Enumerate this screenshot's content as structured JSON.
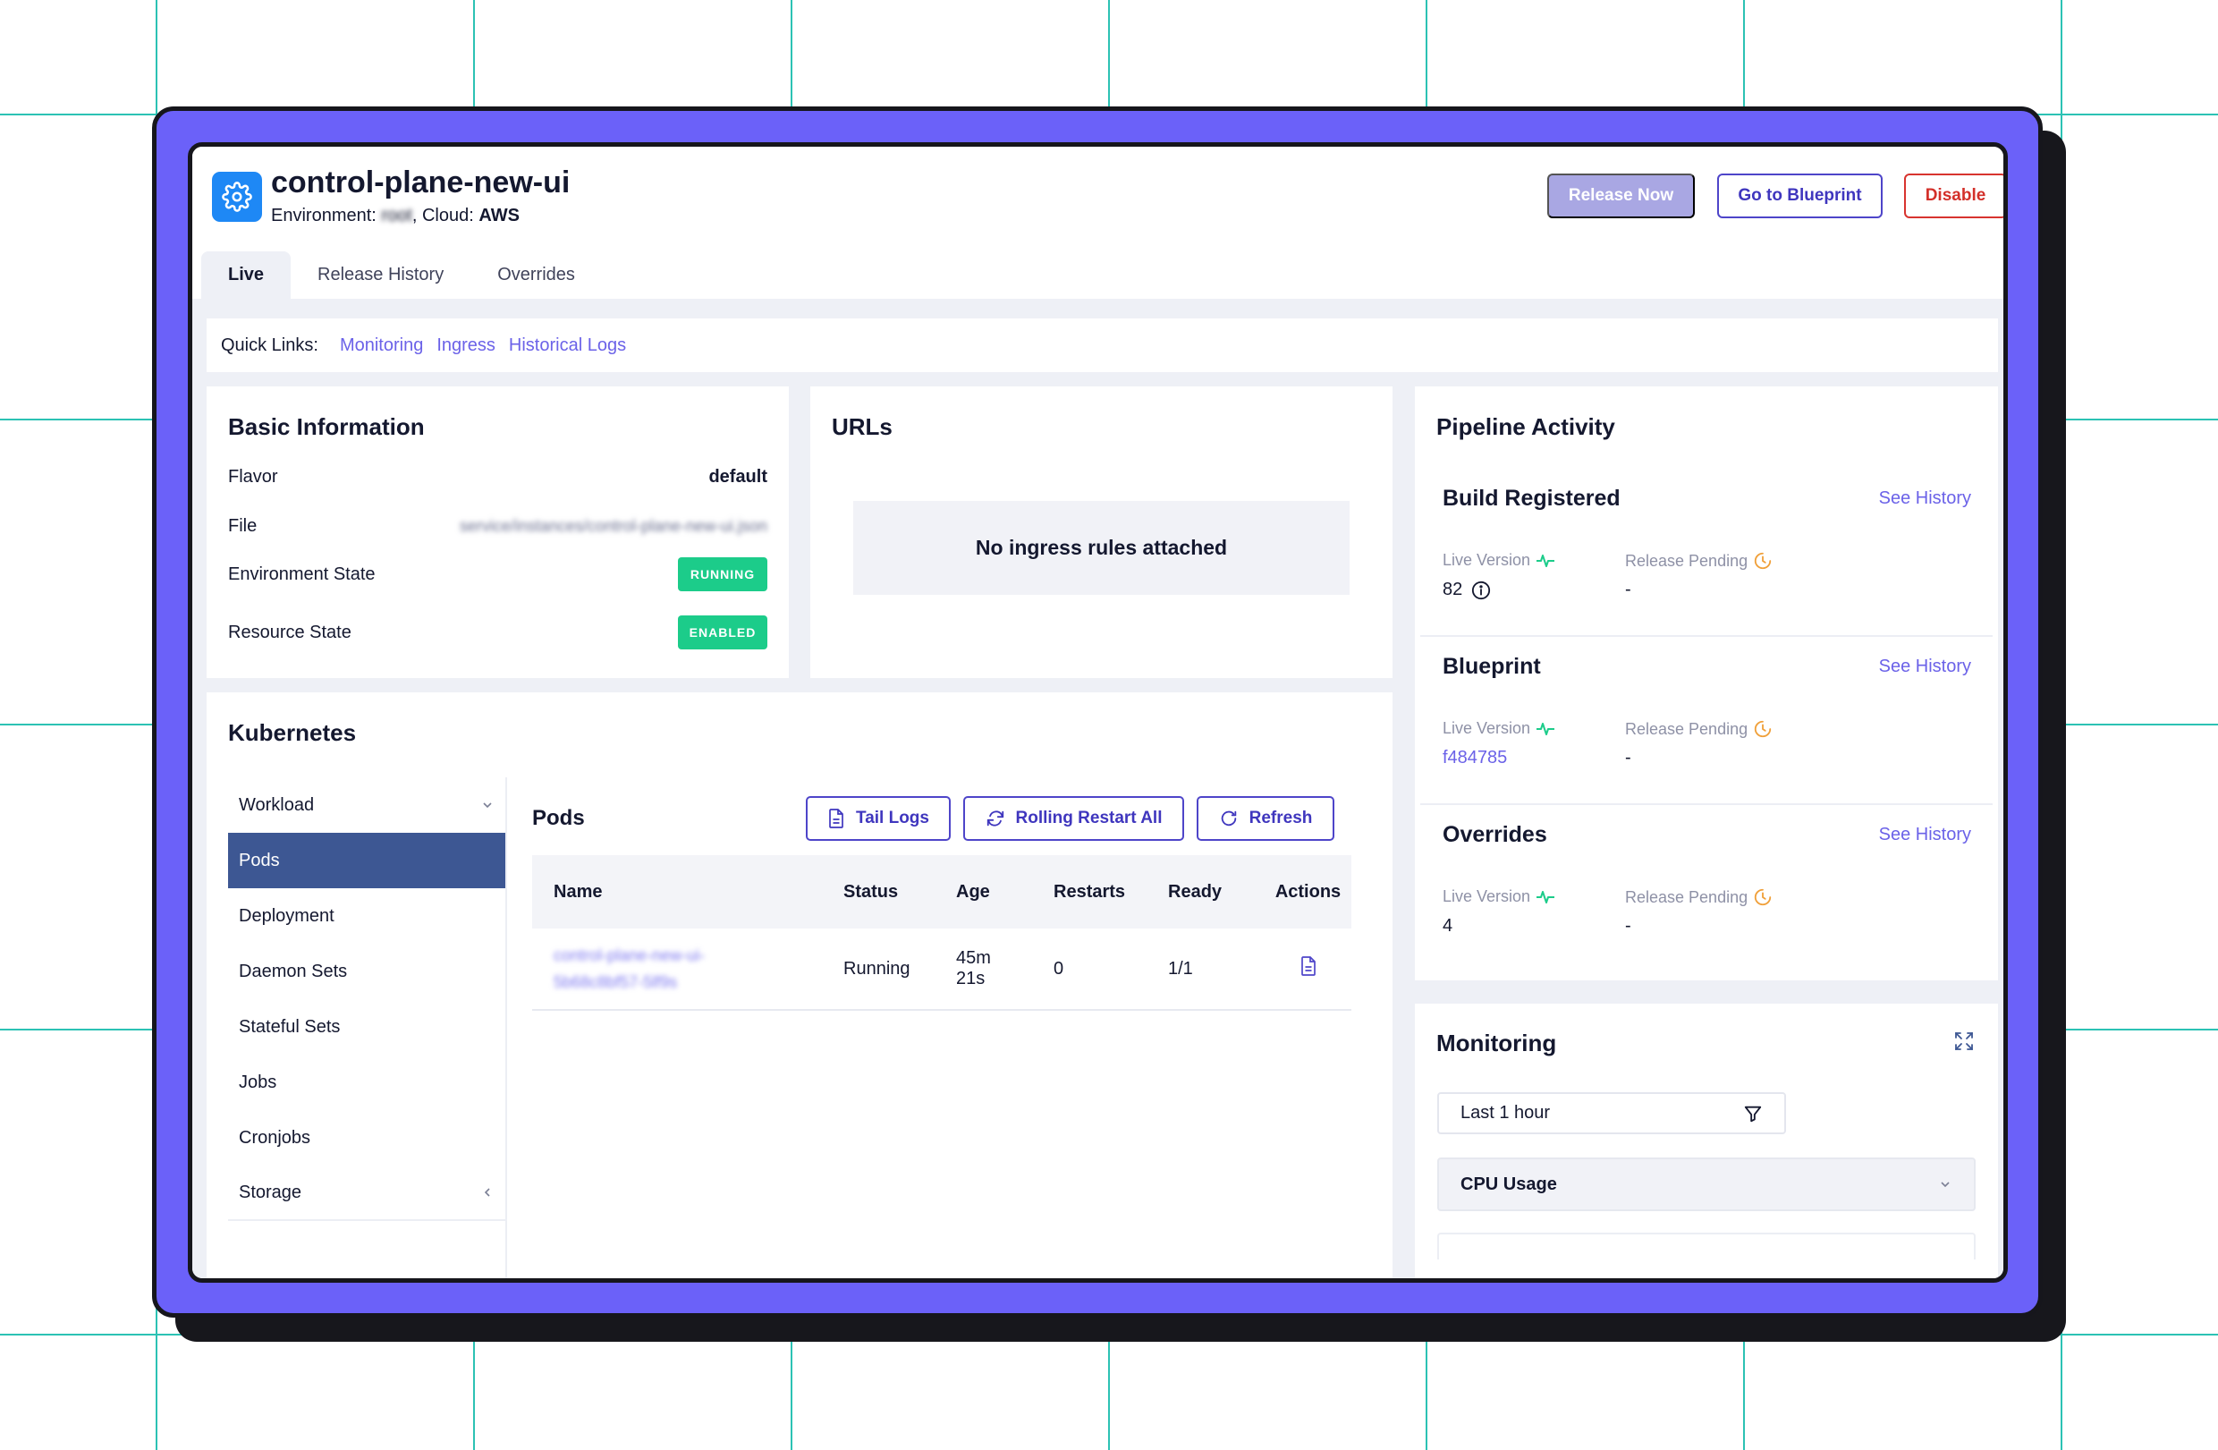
{
  "app": {
    "title": "control-plane-new-ui",
    "environment_label": "Environment:",
    "environment_value": "root",
    "cloud_label": ", Cloud:",
    "cloud_value": "AWS"
  },
  "header_buttons": {
    "release_now": "Release Now",
    "go_to_blueprint": "Go to Blueprint",
    "disable": "Disable"
  },
  "tabs": [
    "Live",
    "Release History",
    "Overrides"
  ],
  "quick_links": {
    "label": "Quick Links:",
    "links": [
      "Monitoring",
      "Ingress",
      "Historical Logs"
    ]
  },
  "basic_info": {
    "title": "Basic Information",
    "rows": [
      {
        "label": "Flavor",
        "value": "default"
      },
      {
        "label": "File",
        "value": "service/instances/control-plane-new-ui.json"
      },
      {
        "label": "Environment State",
        "value": "RUNNING"
      },
      {
        "label": "Resource State",
        "value": "ENABLED"
      }
    ]
  },
  "urls": {
    "title": "URLs",
    "empty_message": "No ingress rules attached"
  },
  "kubernetes": {
    "title": "Kubernetes",
    "nav": [
      "Workload",
      "Pods",
      "Deployment",
      "Daemon Sets",
      "Stateful Sets",
      "Jobs",
      "Cronjobs",
      "Storage"
    ],
    "active_nav": "Pods",
    "pods_title": "Pods",
    "buttons": {
      "tail_logs": "Tail Logs",
      "rolling_restart": "Rolling Restart All",
      "refresh": "Refresh"
    },
    "columns": [
      "Name",
      "Status",
      "Age",
      "Restarts",
      "Ready",
      "Actions"
    ],
    "rows": [
      {
        "name_line1": "control-plane-new-ui-",
        "name_line2": "5b68c8bf57-5lf9s",
        "status": "Running",
        "age_line1": "45m",
        "age_line2": "21s",
        "restarts": "0",
        "ready": "1/1"
      }
    ]
  },
  "pipeline": {
    "title": "Pipeline Activity",
    "live_version_label": "Live Version",
    "release_pending_label": "Release Pending",
    "see_history_label": "See History",
    "sections": [
      {
        "title": "Build Registered",
        "live_version": "82",
        "release_pending": "-"
      },
      {
        "title": "Blueprint",
        "live_version": "f484785",
        "release_pending": "-"
      },
      {
        "title": "Overrides",
        "live_version": "4",
        "release_pending": "-"
      }
    ]
  },
  "monitoring": {
    "title": "Monitoring",
    "time_range": "Last 1 hour",
    "metric": "CPU Usage"
  },
  "colors": {
    "accent": "#6b61f9",
    "primary_button": "#4e45c9",
    "danger": "#d8342f",
    "success": "#1ccc8a",
    "nav_active": "#3d5793",
    "link": "#6b62e8",
    "grid_line": "#2cc2b4"
  },
  "icons": [
    "gear-icon",
    "file-icon",
    "refresh-icon",
    "chevron-down-icon",
    "chevron-left-icon",
    "info-icon",
    "pulse-icon",
    "clock-icon",
    "expand-icon",
    "filter-icon"
  ]
}
